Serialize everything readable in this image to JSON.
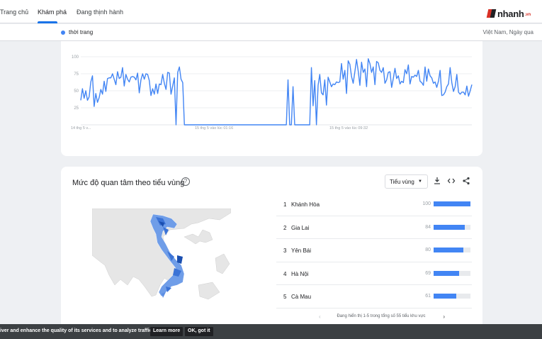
{
  "nav": {
    "tabs": [
      {
        "label": "Trang chủ"
      },
      {
        "label": "Khám phá"
      },
      {
        "label": "Đang thịnh hành"
      }
    ],
    "active_tab": "Khám phá",
    "logo_text": "nhanh",
    "logo_tld": ".vn"
  },
  "subbar": {
    "term": "thời trang",
    "region": "Việt Nam, Ngày qua",
    "series_color": "#4285f4"
  },
  "chart_data": {
    "type": "line",
    "yticks": [
      "100",
      "75",
      "50",
      "25"
    ],
    "ylim": [
      0,
      100
    ],
    "xtick_labels": [
      "14 thg 5 v...",
      "15 thg 5 vào lúc 01:16",
      "15 thg 5 vào lúc 09:32"
    ],
    "grid": true,
    "series": [
      {
        "color": "#4285f4",
        "values": [
          36,
          53,
          39,
          50,
          36,
          41,
          63,
          72,
          27,
          46,
          33,
          40,
          52,
          45,
          64,
          49,
          68,
          69,
          69,
          75,
          67,
          59,
          78,
          68,
          70,
          84,
          57,
          74,
          67,
          63,
          70,
          71,
          70,
          66,
          76,
          47,
          66,
          75,
          67,
          75,
          74,
          65,
          43,
          53,
          45,
          60,
          46,
          60,
          59,
          74,
          61,
          52,
          77,
          76,
          45,
          57,
          69,
          0,
          77,
          85,
          67,
          62,
          0,
          0,
          0,
          0,
          0,
          0,
          0,
          0,
          0,
          0,
          0,
          0,
          0,
          0,
          0,
          0,
          0,
          0,
          0,
          0,
          0,
          0,
          0,
          0,
          0,
          0,
          0,
          0,
          0,
          0,
          0,
          0,
          0,
          0,
          0,
          0,
          0,
          0,
          0,
          0,
          0,
          0,
          0,
          0,
          0,
          0,
          0,
          0,
          0,
          0,
          0,
          0,
          0,
          0,
          0,
          0,
          0,
          0,
          0,
          0,
          0,
          0,
          66,
          0,
          0,
          56,
          0,
          0,
          0,
          0,
          0,
          0,
          0,
          0,
          0,
          0,
          84,
          28,
          65,
          0,
          58,
          74,
          47,
          44,
          66,
          29,
          70,
          63,
          56,
          60,
          59,
          63,
          62,
          63,
          90,
          67,
          80,
          46,
          94,
          89,
          71,
          61,
          78,
          96,
          79,
          58,
          92,
          77,
          82,
          56,
          97,
          90,
          77,
          85,
          59,
          93,
          91,
          80,
          77,
          84,
          61,
          66,
          77,
          78,
          55,
          68,
          83,
          68,
          72,
          60,
          64,
          62,
          81,
          75,
          88,
          60,
          71,
          70,
          73,
          71,
          80,
          64,
          62,
          58,
          85,
          64,
          82,
          72,
          69,
          61,
          63,
          55,
          64,
          80,
          43,
          44,
          48,
          56,
          60,
          84,
          62,
          49,
          56,
          74,
          48,
          45,
          48,
          48,
          44,
          57,
          42,
          50,
          59
        ]
      }
    ]
  },
  "region_panel": {
    "title": "Mức độ quan tâm theo tiểu vùng",
    "help_icon": "?",
    "select_label": "Tiểu vùng",
    "tools": [
      "download-icon",
      "embed-icon",
      "share-icon"
    ],
    "ranking": [
      {
        "rank": "1",
        "name": "Khánh Hòa",
        "value": "100",
        "pct": 100
      },
      {
        "rank": "2",
        "name": "Gia Lai",
        "value": "84",
        "pct": 84
      },
      {
        "rank": "3",
        "name": "Yên Bái",
        "value": "80",
        "pct": 80
      },
      {
        "rank": "4",
        "name": "Hà Nội",
        "value": "69",
        "pct": 69
      },
      {
        "rank": "5",
        "name": "Cà Mau",
        "value": "61",
        "pct": 61
      }
    ],
    "pager_text": "Đang hiển thị 1-5 trong tổng số 55 tiểu khu vực"
  },
  "cookie": {
    "message": "iver and enhance the quality of its services and to analyze traffic.",
    "learn_more": "Learn more",
    "ok": "OK, got it"
  }
}
